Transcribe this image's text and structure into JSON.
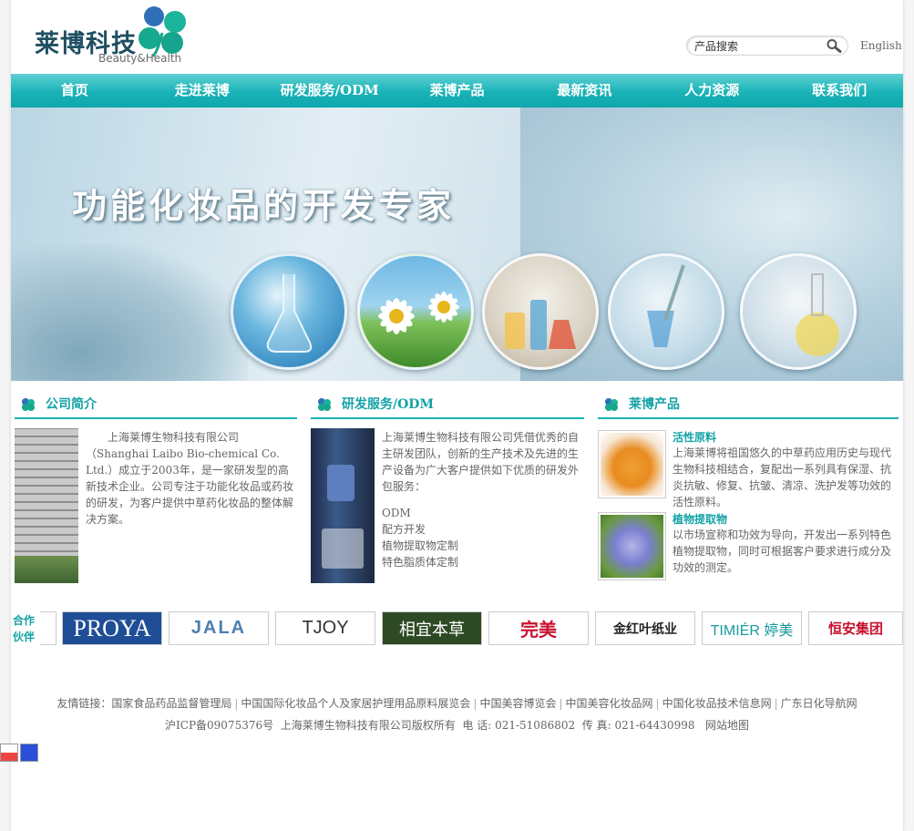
{
  "header": {
    "logo_cn": "莱博科技",
    "logo_en": "Beauty&Health",
    "search_value": "产品搜索",
    "lang_link": "English"
  },
  "nav": [
    "首页",
    "走进莱博",
    "研发服务/ODM",
    "莱博产品",
    "最新资讯",
    "人力资源",
    "联系我们"
  ],
  "banner": {
    "title": "功能化妆品的开发专家"
  },
  "company": {
    "title": "公司简介",
    "text": "上海莱博生物科技有限公司（Shanghai Laibo Bio-chemical Co. Ltd.）成立于2003年，是一家研发型的高新技术企业。公司专注于功能化妆品或药妆的研发，为客户提供中草药化妆品的整体解决方案。"
  },
  "rnd": {
    "title": "研发服务/ODM",
    "text": "上海莱博生物科技有限公司凭借优秀的自主研发团队，创新的生产技术及先进的生产设备为广大客户提供如下优质的研发外包服务：",
    "items": [
      "ODM",
      "配方开发",
      "植物提取物定制",
      "特色脂质体定制"
    ]
  },
  "products": {
    "title": "莱博产品",
    "items": [
      {
        "name": "活性原料",
        "desc": "上海莱博将祖国悠久的中草药应用历史与现代生物科技相结合，复配出一系列具有保湿、抗炎抗敏、修复、抗皱、清凉、洗护发等功效的活性原料。"
      },
      {
        "name": "植物提取物",
        "desc": "以市场宣称和功效为导向，开发出一系列特色植物提取物，同时可根据客户要求进行成分及功效的测定。"
      }
    ]
  },
  "partners": {
    "label": "合作伙伴",
    "logos": [
      "PROYA",
      "JALA",
      "TJOY",
      "相宜本草",
      "完美",
      "金红叶纸业",
      "TIMIÉR 婷美",
      "恒安集团"
    ]
  },
  "footer": {
    "links_label": "友情链接：",
    "links": [
      "国家食品药品监督管理局",
      "中国国际化妆品个人及家居护理用品原料展览会",
      "中国美容博览会",
      "中国美容化妆品网",
      "中国化妆品技术信息网",
      "广东日化导航网"
    ],
    "icp": "沪ICP备09075376号",
    "copyright": "上海莱博生物科技有限公司版权所有",
    "phone": "电  话: 021-51086802",
    "fax": "传  真: 021-64430998",
    "sitemap": "网站地图"
  },
  "colors": {
    "accent": "#14a2a6",
    "nav_top": "#5fd0d3",
    "nav_bottom": "#0ea7ab"
  }
}
